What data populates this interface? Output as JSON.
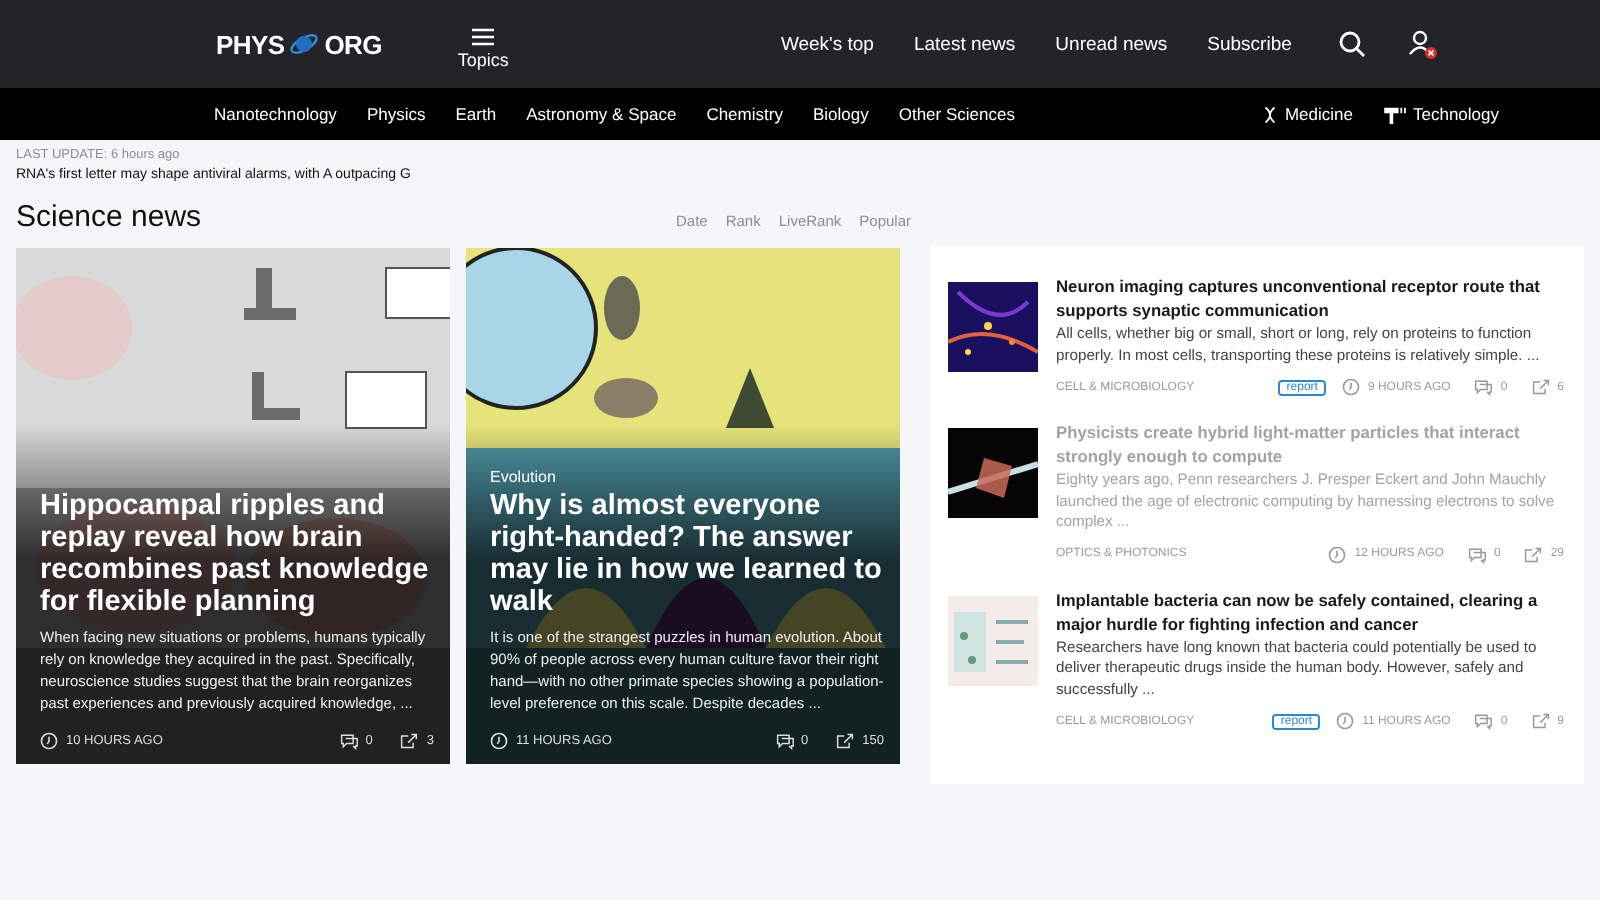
{
  "header": {
    "logo": {
      "left": "PHYS",
      "right": "ORG"
    },
    "topics": "Topics",
    "links": [
      "Week's top",
      "Latest news",
      "Unread news",
      "Subscribe"
    ]
  },
  "categories": [
    {
      "label": "Nanotechnology",
      "kind": "text"
    },
    {
      "label": "Physics",
      "kind": "text"
    },
    {
      "label": "Earth",
      "kind": "text"
    },
    {
      "label": "Astronomy & Space",
      "kind": "text"
    },
    {
      "label": "Chemistry",
      "kind": "text"
    },
    {
      "label": "Biology",
      "kind": "text"
    },
    {
      "label": "Other Sciences",
      "kind": "text"
    },
    {
      "label": "Medicine",
      "kind": "medicine"
    },
    {
      "label": "Technology",
      "kind": "technology"
    }
  ],
  "update": {
    "label": "LAST UPDATE: 6 hours ago",
    "headline": "RNA's first letter may shape antiviral alarms, with A outpacing G"
  },
  "section_title": "Science news",
  "sort_options": [
    "Date",
    "Rank",
    "LiveRank",
    "Popular"
  ],
  "featured": [
    {
      "title": "Hippocampal ripples and replay reveal how brain recombines past knowledge for flexible planning",
      "summary": "When facing new situations or problems, humans typically rely on knowledge they acquired in the past. Specifically, neuroscience studies suggest that the brain reorganizes past experiences and previously acquired knowledge, ...",
      "time": "10 HOURS AGO",
      "comments": "0",
      "shares": "3",
      "kind": "figure"
    },
    {
      "tag": "Evolution",
      "title": "Why is almost everyone right-handed? The answer may lie in how we learned to walk",
      "summary": "It is one of the strangest puzzles in human evolution. About 90% of people across every human culture favor their right hand—with no other primate species showing a population-level preference on this scale. Despite decades ...",
      "time": "11 HOURS AGO",
      "comments": "0",
      "shares": "150",
      "kind": "poster"
    }
  ],
  "list": [
    {
      "title": "Neuron imaging captures unconventional receptor route that supports synaptic communication",
      "summary": "All cells, whether big or small, short or long, rely on proteins to function properly. In most cells, transporting these proteins is relatively simple. ...",
      "category": "CELL & MICROBIOLOGY",
      "badge": "report",
      "time": "9 HOURS AGO",
      "comments": "0",
      "shares": "6",
      "read": false,
      "kind": "micro"
    },
    {
      "title": "Physicists create hybrid light-matter particles that interact strongly enough to compute",
      "summary": "Eighty years ago, Penn researchers J. Presper Eckert and John Mauchly launched the age of electronic computing by harnessing electrons to solve complex ...",
      "category": "OPTICS & PHOTONICS",
      "time": "12 HOURS AGO",
      "comments": "0",
      "shares": "29",
      "read": true,
      "kind": "beam"
    },
    {
      "title": "Implantable bacteria can now be safely contained, clearing a major hurdle for fighting infection and cancer",
      "summary": "Researchers have long known that bacteria could potentially be used to deliver therapeutic drugs inside the human body. However, safely and successfully ...",
      "category": "CELL & MICROBIOLOGY",
      "badge": "report",
      "time": "11 HOURS AGO",
      "comments": "0",
      "shares": "9",
      "read": false,
      "kind": "diagram"
    }
  ]
}
